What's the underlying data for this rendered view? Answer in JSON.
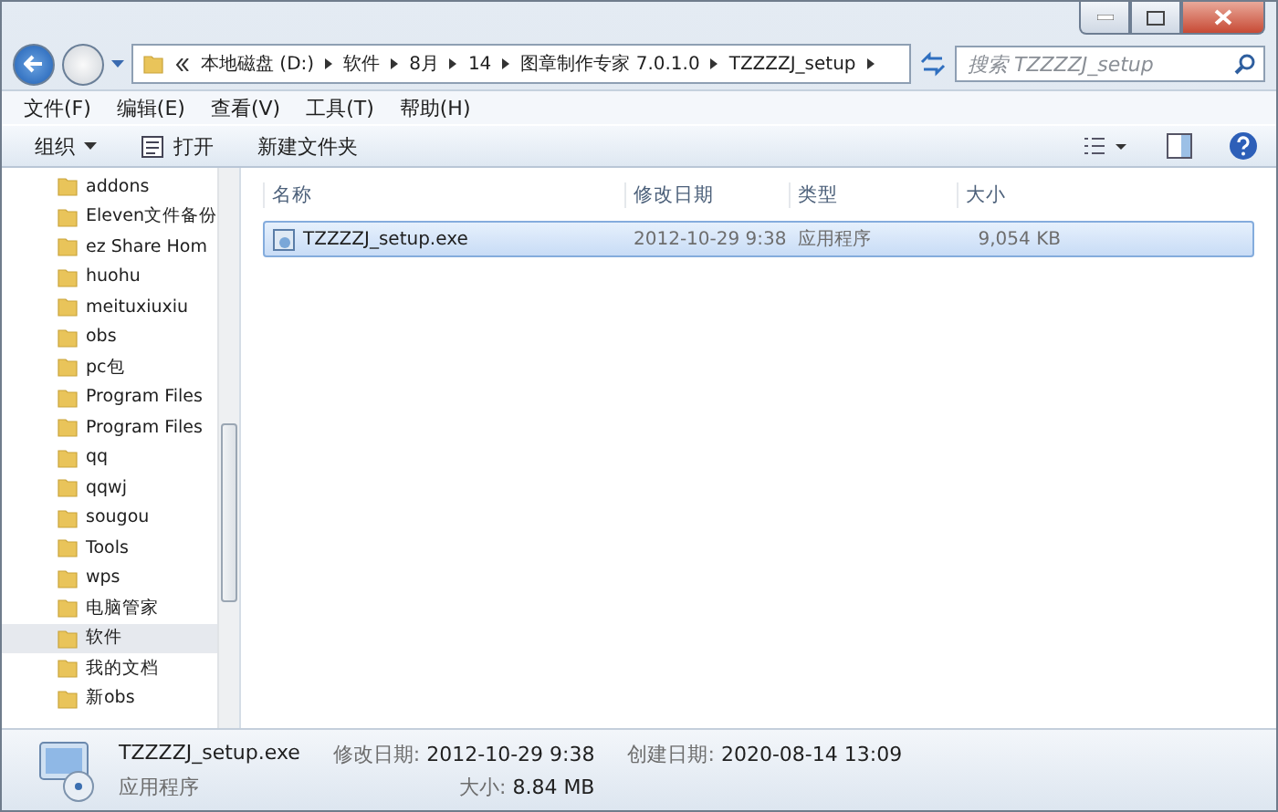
{
  "address_bar": {
    "crumbs": [
      "本地磁盘 (D:)",
      "软件",
      "8月",
      "14",
      "图章制作专家 7.0.1.0",
      "TZZZZJ_setup"
    ]
  },
  "search": {
    "placeholder": "搜索 TZZZZJ_setup"
  },
  "menu": [
    "文件(F)",
    "编辑(E)",
    "查看(V)",
    "工具(T)",
    "帮助(H)"
  ],
  "toolbar": {
    "buttons": [
      {
        "label": "组织",
        "kind": "dropdown"
      },
      {
        "label": "打开",
        "kind": "icon"
      },
      {
        "label": "新建文件夹",
        "kind": "plain"
      }
    ]
  },
  "sidebar": {
    "items": [
      {
        "label": "addons",
        "selected": false
      },
      {
        "label": "Eleven文件备份",
        "selected": false
      },
      {
        "label": "ez Share Hom",
        "selected": false
      },
      {
        "label": "huohu",
        "selected": false
      },
      {
        "label": "meituxiuxiu",
        "selected": false
      },
      {
        "label": "obs",
        "selected": false
      },
      {
        "label": "pc包",
        "selected": false
      },
      {
        "label": "Program Files",
        "selected": false
      },
      {
        "label": "Program Files",
        "selected": false
      },
      {
        "label": "qq",
        "selected": false
      },
      {
        "label": "qqwj",
        "selected": false
      },
      {
        "label": "sougou",
        "selected": false
      },
      {
        "label": "Tools",
        "selected": false
      },
      {
        "label": "wps",
        "selected": false
      },
      {
        "label": "电脑管家",
        "selected": false
      },
      {
        "label": "软件",
        "selected": true
      },
      {
        "label": "我的文档",
        "selected": false
      },
      {
        "label": "新obs",
        "selected": false
      }
    ]
  },
  "table": {
    "columns": [
      "名称",
      "修改日期",
      "类型",
      "大小"
    ],
    "rows": [
      {
        "name": "TZZZZJ_setup.exe",
        "modified": "2012-10-29 9:38",
        "type": "应用程序",
        "size": "9,054 KB",
        "selected": true
      }
    ]
  },
  "details": {
    "name": "TZZZZJ_setup.exe",
    "type": "应用程序",
    "modified_label": "修改日期:",
    "modified": "2012-10-29 9:38",
    "created_label": "创建日期:",
    "created": "2020-08-14 13:09",
    "size_label": "大小:",
    "size": "8.84 MB"
  }
}
